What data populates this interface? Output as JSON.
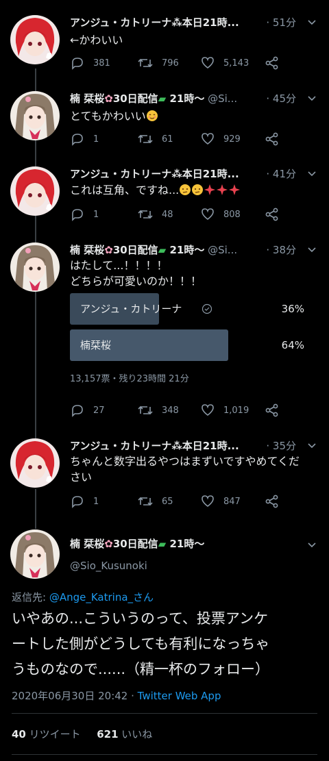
{
  "tweets": [
    {
      "name": "アンジュ・カトリーナ",
      "name_suffix": "本日21時...",
      "handle": "",
      "time": "· 51分",
      "text": "←かわいい",
      "replies": "381",
      "retweets": "796",
      "likes": "5,143",
      "avatar": "red"
    },
    {
      "name": "楠 栞桜",
      "name_suffix": "30日配信",
      "name_suffix2": " 21時〜",
      "handle": " @Si...",
      "time": "· 45分",
      "text": "とてもかわいい",
      "replies": "1",
      "retweets": "61",
      "likes": "929",
      "avatar": "brown"
    },
    {
      "name": "アンジュ・カトリーナ",
      "name_suffix": "本日21時...",
      "handle": "",
      "time": "· 41分",
      "text": "これは互角、ですね...",
      "replies": "1",
      "retweets": "48",
      "likes": "808",
      "avatar": "red"
    },
    {
      "name": "楠 栞桜",
      "name_suffix": "30日配信",
      "name_suffix2": " 21時〜",
      "handle": " @Si...",
      "time": "· 38分",
      "text_line1": "はたして...！！！！",
      "text_line2": "どちらが可愛いのか！！！",
      "poll": {
        "options": [
          {
            "label": "アンジュ・カトリーナ",
            "percent": "36%",
            "fraction": 0.36
          },
          {
            "label": "楠栞桜",
            "percent": "64%",
            "fraction": 0.64
          }
        ],
        "meta": "13,157票・残り23時間 21分"
      },
      "replies": "27",
      "retweets": "348",
      "likes": "1,019",
      "avatar": "brown"
    },
    {
      "name": "アンジュ・カトリーナ",
      "name_suffix": "本日21時...",
      "handle": "",
      "time": "· 35分",
      "text_line1": "ちゃんと数字出るやつはまずいですやめてくだ",
      "text_line2": "さい",
      "replies": "1",
      "retweets": "65",
      "likes": "847",
      "avatar": "red"
    }
  ],
  "main": {
    "name": "楠 栞桜",
    "name_suffix": "30日配信",
    "name_suffix2": " 21時〜",
    "handle": "@Sio_Kusunoki",
    "reply_label": "返信先: ",
    "reply_to": "@Ange_Katrina_さん",
    "text_line1": "いやあの...こういうのって、投票アンケ",
    "text_line2": "ートした側がどうしても有利になっちゃ",
    "text_line3": "うものなので......（精一杯のフォロー）",
    "date": "2020年06月30日 20:42 · ",
    "app": "Twitter Web App",
    "retweet_count": "40",
    "retweet_label": " リツイート",
    "like_count": "621",
    "like_label": " いいね"
  },
  "colors": {
    "background": "#000000",
    "text": "#e7e9ea",
    "muted": "#8b98a5",
    "link": "#1d9bf0",
    "poll_bar": "#3a4a5a",
    "poll_bar_winner": "#46586b"
  }
}
